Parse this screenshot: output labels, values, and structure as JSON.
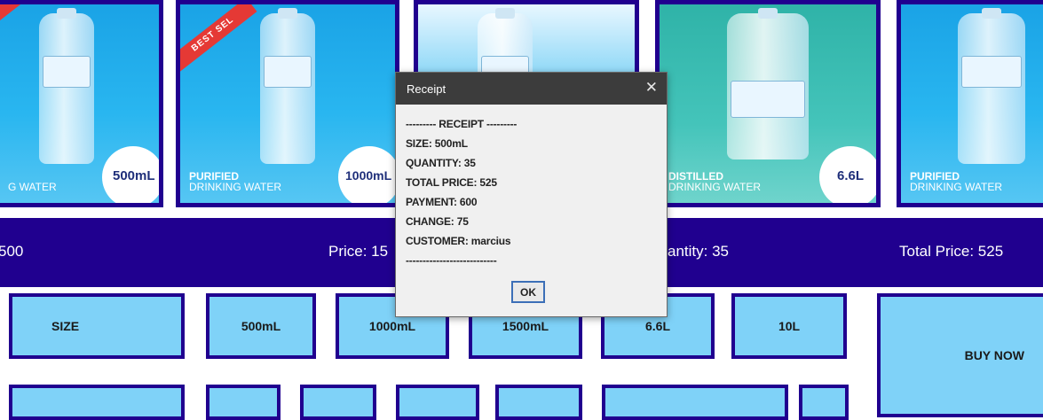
{
  "products": [
    {
      "title": "",
      "subtitle": "G WATER",
      "size": "500mL",
      "ribbon": ""
    },
    {
      "title": "PURIFIED",
      "subtitle": "DRINKING WATER",
      "size": "1000mL",
      "ribbon": "BEST SEL"
    },
    {
      "title": "",
      "subtitle": "",
      "size": "",
      "ribbon": ""
    },
    {
      "title": "DISTILLED",
      "subtitle": "DRINKING WATER",
      "size": "6.6L",
      "ribbon": ""
    },
    {
      "title": "PURIFIED",
      "subtitle": "DRINKING WATER",
      "size": "",
      "ribbon": ""
    }
  ],
  "info_bar": {
    "payment": "500",
    "price": "Price: 15",
    "quantity": "antity: 35",
    "total": "Total Price: 525"
  },
  "buttons": {
    "size": "SIZE",
    "s500": "500mL",
    "s1000": "1000mL",
    "s1500": "1500mL",
    "s66": "6.6L",
    "s10": "10L",
    "buy": "BUY NOW"
  },
  "dialog": {
    "title": "Receipt",
    "close": "✕",
    "lines": [
      "--------- RECEIPT ---------",
      "SIZE: 500mL",
      "QUANTITY: 35",
      "TOTAL PRICE: 525",
      "PAYMENT: 600",
      "CHANGE: 75",
      "CUSTOMER: marcius",
      "---------------------------"
    ],
    "ok": "OK"
  }
}
